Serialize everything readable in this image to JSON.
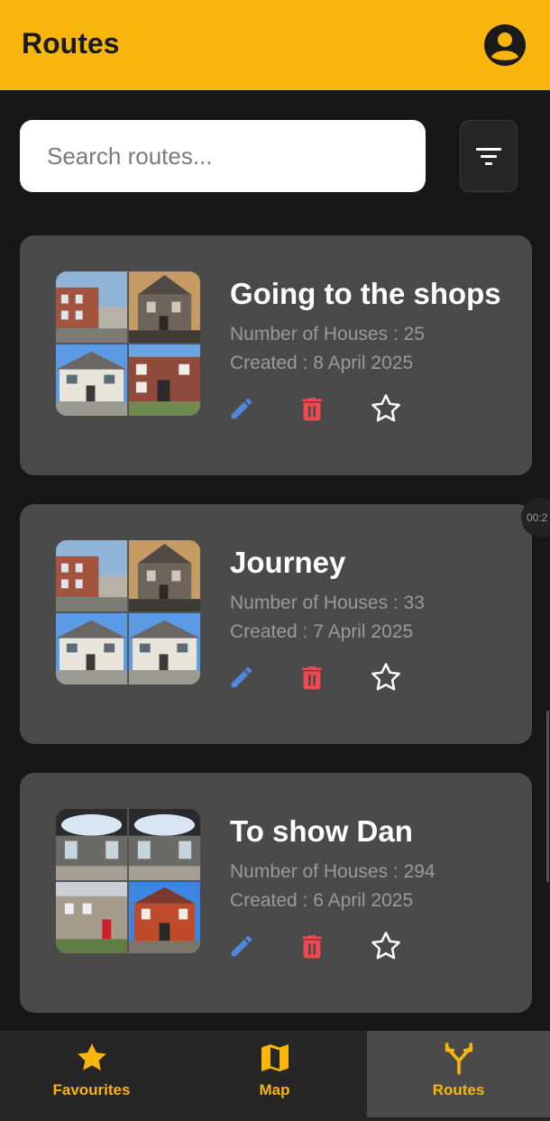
{
  "app": {
    "title": "Routes",
    "accent": "#F8B50B"
  },
  "search": {
    "placeholder": "Search routes..."
  },
  "routes": [
    {
      "name": "Going to the shops",
      "houses": "Number of Houses : 25",
      "created": "Created : 8 April 2025"
    },
    {
      "name": "Journey",
      "houses": "Number of Houses : 33",
      "created": "Created : 7 April 2025"
    },
    {
      "name": "To show Dan",
      "houses": "Number of Houses : 294",
      "created": "Created : 6 April 2025"
    }
  ],
  "overlay": {
    "timer": "00:2"
  },
  "nav": {
    "items": [
      {
        "label": "Favourites",
        "icon": "star-icon"
      },
      {
        "label": "Map",
        "icon": "map-icon"
      },
      {
        "label": "Routes",
        "icon": "route-fork-icon",
        "active": true
      }
    ]
  },
  "colors": {
    "edit": "#4F86E0",
    "delete": "#F0484E",
    "favourite": "#FFFFFF"
  }
}
